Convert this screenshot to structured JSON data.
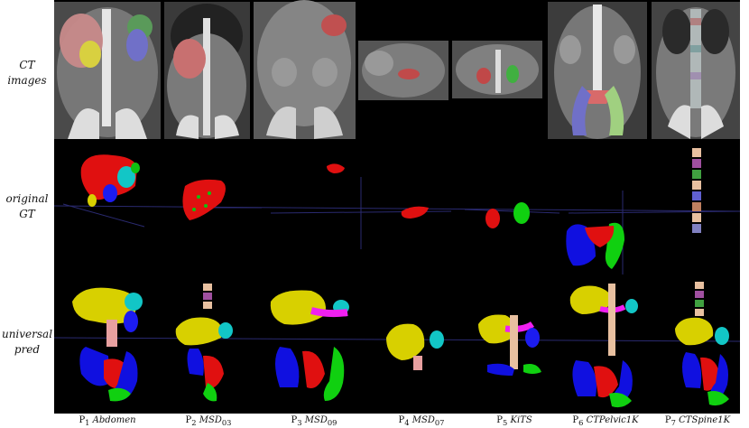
{
  "row_labels": [
    {
      "line1": "CT",
      "line2": "images"
    },
    {
      "line1": "original",
      "line2": "GT"
    },
    {
      "line1": "universal",
      "line2": "pred"
    }
  ],
  "columns": [
    {
      "p": "P",
      "sub": "1",
      "name": "Abdomen",
      "name_sub": ""
    },
    {
      "p": "P",
      "sub": "2",
      "name": "MSD",
      "name_sub": "03"
    },
    {
      "p": "P",
      "sub": "3",
      "name": "MSD",
      "name_sub": "09"
    },
    {
      "p": "P",
      "sub": "4",
      "name": "MSD",
      "name_sub": "07"
    },
    {
      "p": "P",
      "sub": "5",
      "name": "KiTS",
      "name_sub": ""
    },
    {
      "p": "P",
      "sub": "6",
      "name": "CTPelvic1K",
      "name_sub": ""
    },
    {
      "p": "P",
      "sub": "7",
      "name": "CTSpine1K",
      "name_sub": ""
    }
  ],
  "colors": {
    "liver": "#d8d000",
    "liver_gt": "#e01010",
    "spleen": "#12c6c6",
    "kidney": "#1c1cf0",
    "pancreas": "#f020f0",
    "spine": "#e8c0a0",
    "pelvis": "#1010e0",
    "femur": "#10d010",
    "bladder": "#e01010"
  }
}
